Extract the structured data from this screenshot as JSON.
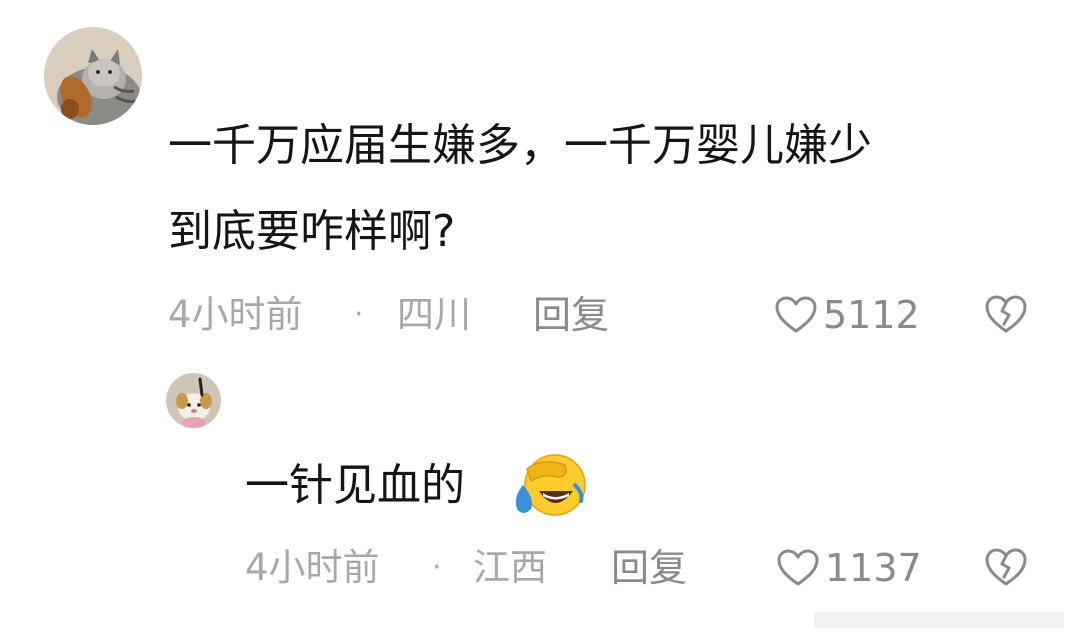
{
  "comments": [
    {
      "text_line1": "一千万应届生嫌多，一千万婴儿嫌少",
      "text_line2": "到底要咋样啊?",
      "time": "4小时前",
      "separator": "·",
      "location": "四川",
      "reply_label": "回复",
      "like_count": "5112"
    }
  ],
  "replies": [
    {
      "text": "一针见血的",
      "emoji": "laughing-crying-emoji",
      "time": "4小时前",
      "separator": "·",
      "location": "江西",
      "reply_label": "回复",
      "like_count": "1137"
    }
  ],
  "icons": {
    "like": "heart-outline-icon",
    "dislike": "broken-heart-icon"
  },
  "colors": {
    "text": "#151515",
    "meta": "#a8a8a8",
    "action": "#8a8a8a",
    "background": "#ffffff"
  }
}
